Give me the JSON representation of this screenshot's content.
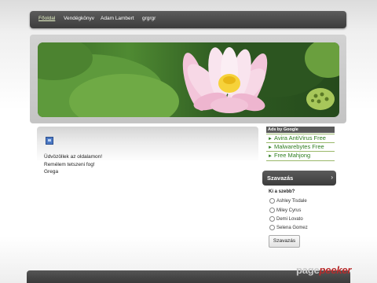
{
  "nav": {
    "items": [
      "Főoldal",
      "Vendégkönyv",
      "Adam Lambert",
      "grgrgr"
    ],
    "active_index": 0
  },
  "content": {
    "welcome": "Üdvözöllek az oldalamon!",
    "hope": "Remélem tetszeni fog!",
    "signature": "Grega"
  },
  "ads": {
    "header": "Ads by Google",
    "links": [
      "Avira AntiVirus Free",
      "Malwarebytes Free",
      "Free Mahjong"
    ]
  },
  "poll": {
    "title": "Szavazás",
    "question": "Ki a szebb?",
    "options": [
      "Ashley Tisdale",
      "Miley Cyrus",
      "Demi Lovato",
      "Selena Gomez"
    ],
    "vote_label": "Szavazás"
  },
  "watermark": {
    "page": "page",
    "peeker": "peeker"
  },
  "colors": {
    "nav_bg": "#4a4a4a",
    "ad_link": "#2e7d1f",
    "watermark_red": "#b82b2b"
  }
}
